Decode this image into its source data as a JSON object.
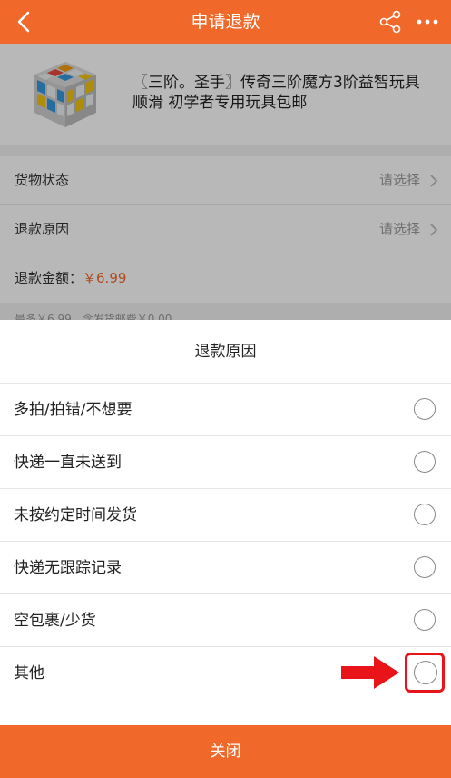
{
  "header": {
    "title": "申请退款",
    "back_icon": "chevron-left-icon",
    "share_icon": "share-icon",
    "more_icon": "more-horizontal-icon",
    "bar_color": "#f0692b"
  },
  "product": {
    "image_icon": "rubiks-cube-image",
    "title": "〖三阶。圣手〗传奇三阶魔方3阶益智玩具顺滑 初学者专用玩具包邮"
  },
  "form": {
    "goods_status_label": "货物状态",
    "goods_status_value": "请选择",
    "refund_reason_label": "退款原因",
    "refund_reason_value": "请选择",
    "refund_amount_label": "退款金额：",
    "refund_amount_value": "￥6.99",
    "note": "最多￥6.99，含发货邮费￥0.00"
  },
  "sheet": {
    "title": "退款原因",
    "options": [
      {
        "label": "多拍/拍错/不想要",
        "selected": false
      },
      {
        "label": "快递一直未送到",
        "selected": false
      },
      {
        "label": "未按约定时间发货",
        "selected": false
      },
      {
        "label": "快递无跟踪记录",
        "selected": false
      },
      {
        "label": "空包裹/少货",
        "selected": false
      },
      {
        "label": "其他",
        "selected": false
      }
    ],
    "close_label": "关闭"
  },
  "annotation": {
    "arrow_icon": "red-arrow-right-icon",
    "highlight_color": "#e8141a"
  }
}
